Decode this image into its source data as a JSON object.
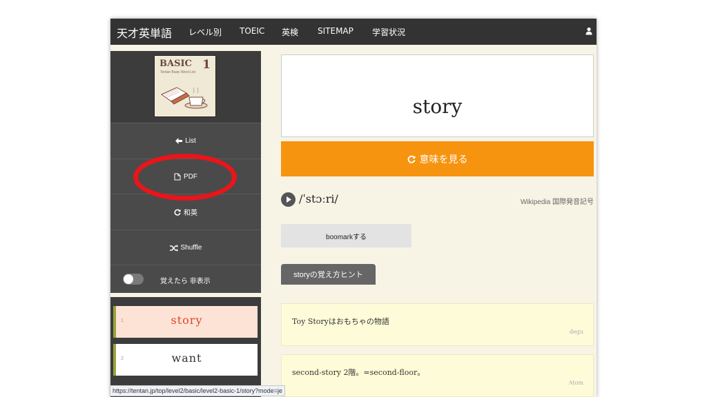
{
  "header": {
    "brand": "天才英単語",
    "nav": [
      "レベル別",
      "TOEIC",
      "英検",
      "SITEMAP",
      "学習状況"
    ]
  },
  "sidebar": {
    "book": {
      "title": "BASIC",
      "number": "1",
      "subtitle": "Tentan Basic Word List"
    },
    "menu": {
      "list": "List",
      "pdf": "PDF",
      "wa_ei": "和英",
      "shuffle": "Shuffle"
    },
    "toggle_label": "覚えたら 非表示",
    "words": [
      {
        "num": "1",
        "word": "story",
        "active": true
      },
      {
        "num": "2",
        "word": "want",
        "active": false
      }
    ]
  },
  "main": {
    "word": "story",
    "meaning_button": "意味を見る",
    "pronunciation": "/ˈstɔːri/",
    "wiki_label": "Wikipedia 国際発音記号",
    "bookmark_button": "boomarkする",
    "hint_tab": "storyの覚え方ヒント",
    "hints": [
      {
        "text": "Toy Storyはおもちゃの物語",
        "author": "degu"
      },
      {
        "text": "second-story 2階。=second-floor。",
        "author": "Atom"
      }
    ]
  },
  "status_url": "https://tentan.jp/top/level2/basic/level2-basic-1/story?mode=je",
  "colors": {
    "accent": "#f7940f",
    "annotation": "#e8151b",
    "topbar": "#333333"
  }
}
